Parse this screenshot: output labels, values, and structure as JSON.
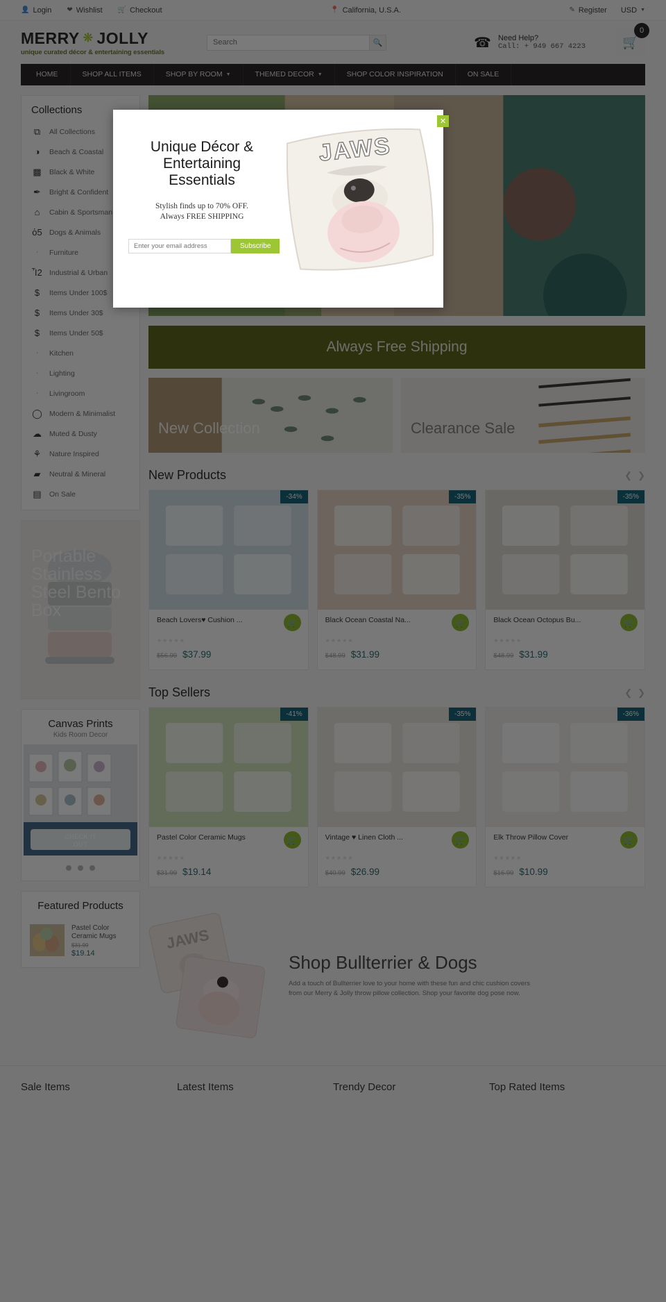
{
  "topbar": {
    "login": "Login",
    "wishlist": "Wishlist",
    "checkout": "Checkout",
    "location": "California, U.S.A.",
    "register": "Register",
    "currency": "USD"
  },
  "header": {
    "logo_main_left": "MERRY",
    "logo_main_right": "JOLLY",
    "logo_tagline": "unique curated décor & entertaining essentials",
    "search_placeholder": "Search",
    "search_value": "",
    "help_title": "Need Help?",
    "help_phone": "Call: + 949 667 4223",
    "cart_count": "0"
  },
  "nav": [
    {
      "label": "HOME",
      "has_caret": false
    },
    {
      "label": "SHOP ALL ITEMS",
      "has_caret": false
    },
    {
      "label": "SHOP BY ROOM",
      "has_caret": true
    },
    {
      "label": "THEMED DECOR",
      "has_caret": true
    },
    {
      "label": "SHOP COLOR INSPIRATION",
      "has_caret": false
    },
    {
      "label": "ON SALE",
      "has_caret": false
    }
  ],
  "sidebar": {
    "collections_title": "Collections",
    "collections": [
      {
        "label": "All Collections",
        "icon": "tag-plus-icon",
        "glyph": "⧉",
        "plain": false
      },
      {
        "label": "Beach & Coastal",
        "icon": "shell-icon",
        "glyph": "◑",
        "plain": false
      },
      {
        "label": "Black & White",
        "icon": "squares-icon",
        "glyph": "▩",
        "plain": false
      },
      {
        "label": "Bright & Confident",
        "icon": "brush-icon",
        "glyph": "✒",
        "plain": false
      },
      {
        "label": "Cabin & Sportsman",
        "icon": "cabin-icon",
        "glyph": "⌂",
        "plain": false
      },
      {
        "label": "Dogs & Animals",
        "icon": "dog-icon",
        "glyph": "ὁ5",
        "plain": false
      },
      {
        "label": "Furniture",
        "icon": "bullet-icon",
        "glyph": "▪",
        "plain": true
      },
      {
        "label": "Industrial & Urban",
        "icon": "building-icon",
        "glyph": "Ἶ2",
        "plain": false
      },
      {
        "label": "Items Under 100$",
        "icon": "dollar-circle-icon",
        "glyph": "$",
        "plain": false
      },
      {
        "label": "Items Under 30$",
        "icon": "dollar-circle-icon",
        "glyph": "$",
        "plain": false
      },
      {
        "label": "Items Under 50$",
        "icon": "dollar-circle-icon",
        "glyph": "$",
        "plain": false
      },
      {
        "label": "Kitchen",
        "icon": "bullet-icon",
        "glyph": "▪",
        "plain": true
      },
      {
        "label": "Lighting",
        "icon": "bullet-icon",
        "glyph": "▪",
        "plain": true
      },
      {
        "label": "Livingroom",
        "icon": "bullet-icon",
        "glyph": "▪",
        "plain": true
      },
      {
        "label": "Modern & Minimalist",
        "icon": "circle-icon",
        "glyph": "◯",
        "plain": false
      },
      {
        "label": "Muted & Dusty",
        "icon": "cloud-icon",
        "glyph": "☁",
        "plain": false
      },
      {
        "label": "Nature Inspired",
        "icon": "leaf-icon",
        "glyph": "⚘",
        "plain": false
      },
      {
        "label": "Neutral & Mineral",
        "icon": "stone-icon",
        "glyph": "▰",
        "plain": false
      },
      {
        "label": "On Sale",
        "icon": "sale-icon",
        "glyph": "▤",
        "plain": false
      }
    ],
    "promo_text": "Portable Stainless Steel Bento Box",
    "canvas_title": "Canvas Prints",
    "canvas_sub": "Kids Room Decor",
    "canvas_cta_line1": "CHECK IT",
    "canvas_cta_line2": "OUT",
    "featured_title": "Featured Products",
    "featured_item": {
      "name": "Pastel Color Ceramic Mugs",
      "old_price": "$31.99",
      "price": "$19.14"
    }
  },
  "main": {
    "free_shipping": "Always Free Shipping",
    "banner_new": "New Collection",
    "banner_clearance": "Clearance Sale",
    "sections": [
      {
        "title": "New Products",
        "products": [
          {
            "name": "Beach Lovers♥ Cushion ...",
            "discount": "-34%",
            "old_price": "$56.99",
            "price": "$37.99"
          },
          {
            "name": "Black Ocean Coastal Na...",
            "discount": "-35%",
            "old_price": "$48.99",
            "price": "$31.99"
          },
          {
            "name": "Black Ocean Octopus Bu...",
            "discount": "-35%",
            "old_price": "$48.99",
            "price": "$31.99"
          }
        ]
      },
      {
        "title": "Top Sellers",
        "products": [
          {
            "name": "Pastel Color Ceramic Mugs",
            "discount": "-41%",
            "old_price": "$31.99",
            "price": "$19.14"
          },
          {
            "name": "Vintage ♥ Linen Cloth ...",
            "discount": "-35%",
            "old_price": "$40.99",
            "price": "$26.99"
          },
          {
            "name": "Elk Throw Pillow Cover",
            "discount": "-36%",
            "old_price": "$16.99",
            "price": "$10.99"
          }
        ]
      }
    ],
    "bullterrier": {
      "title": "Shop Bullterrier & Dogs",
      "body": "Add a touch of Bullterrier love to your home with these fun and chic cushion covers from our Merry & Jolly throw pillow collection. Shop your favorite dog pose now."
    }
  },
  "footer_tabs": [
    "Sale Items",
    "Latest Items",
    "Trendy Decor",
    "Top Rated Items"
  ],
  "modal": {
    "heading": "Unique Décor & Entertaining Essentials",
    "sub_line1": "Stylish finds up to 70% OFF.",
    "sub_line2": "Always FREE SHIPPING",
    "email_placeholder": "Enter your email address",
    "email_value": "",
    "subscribe_label": "Subscribe",
    "close_label": "✕"
  },
  "colors": {
    "accent_green": "#9dc634",
    "dark_nav": "#2b2726",
    "price_teal": "#2f6b6f",
    "discount_badge": "#17647a",
    "olive_banner": "#5e661f"
  }
}
